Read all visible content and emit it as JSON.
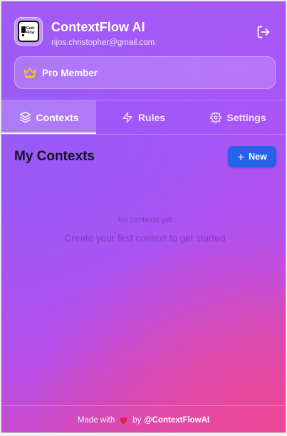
{
  "header": {
    "app_title": "ContextFlow AI",
    "email": "rijos.christopher@gmail.com",
    "logout_icon": "logout-icon",
    "logo_icon": "contextflow-logo"
  },
  "membership": {
    "label": "Pro Member",
    "icon": "crown-icon",
    "icon_color": "#facc15"
  },
  "tabs": [
    {
      "label": "Contexts",
      "icon": "layers-icon",
      "active": true
    },
    {
      "label": "Rules",
      "icon": "lightning-icon",
      "active": false
    },
    {
      "label": "Settings",
      "icon": "gear-icon",
      "active": false
    }
  ],
  "main": {
    "title": "My Contexts",
    "new_button": "New",
    "empty_title": "No contexts yet",
    "empty_subtitle": "Create your first context to get started"
  },
  "footer": {
    "made_with": "Made with",
    "by": "by",
    "handle": "@ContextFlowAI",
    "heart_color": "#e11d48"
  },
  "colors": {
    "accent_button": "#2563eb",
    "gradient_start": "#a75bf6",
    "gradient_end": "#e2479f"
  }
}
